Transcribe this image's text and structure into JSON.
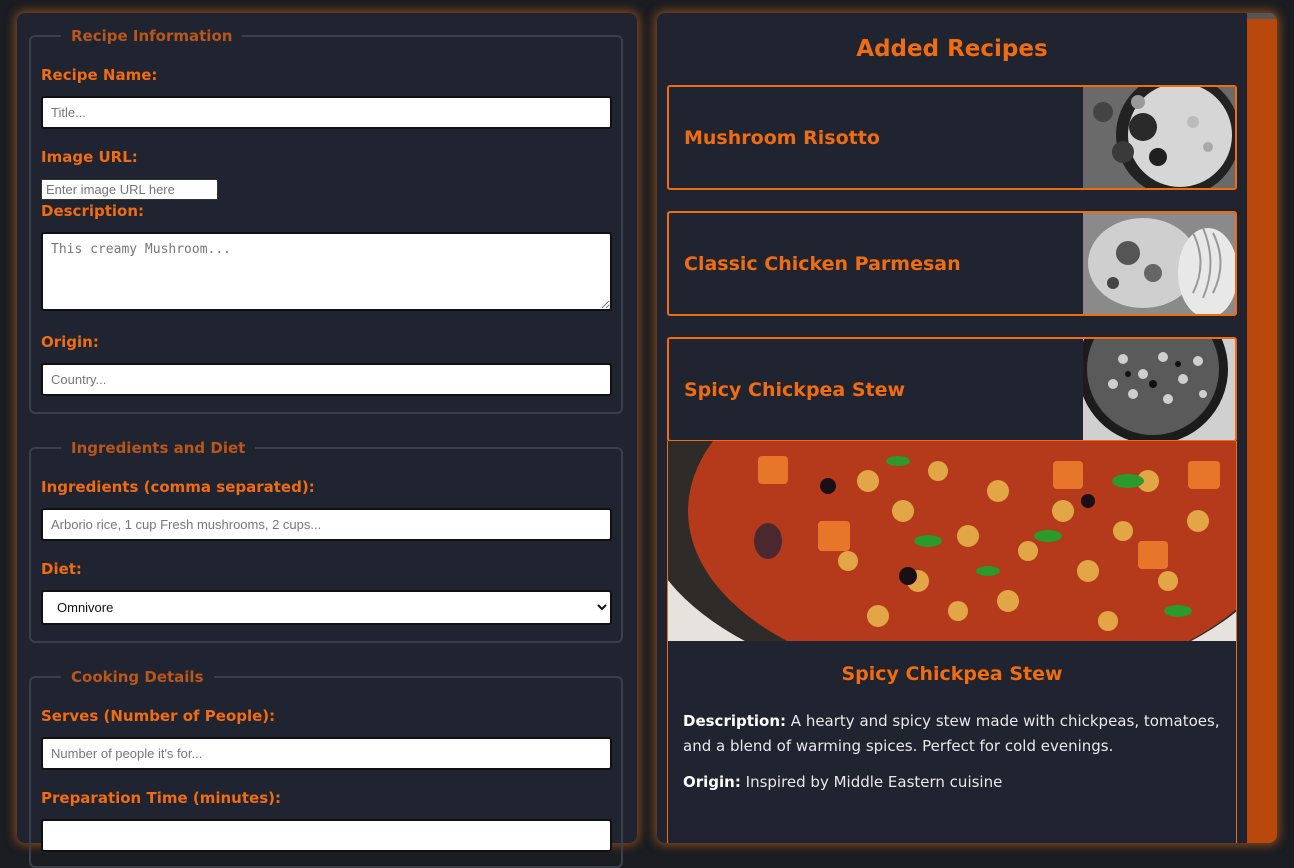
{
  "form": {
    "recipe_info": {
      "legend": "Recipe Information",
      "name_label": "Recipe Name:",
      "name_placeholder": "Title...",
      "image_label": "Image URL:",
      "image_placeholder": "Enter image URL here",
      "description_label": "Description:",
      "description_placeholder": "This creamy Mushroom...",
      "origin_label": "Origin:",
      "origin_placeholder": "Country..."
    },
    "ingredients_diet": {
      "legend": "Ingredients and Diet",
      "ingredients_label": "Ingredients (comma separated):",
      "ingredients_placeholder": "Arborio rice, 1 cup Fresh mushrooms, 2 cups...",
      "diet_label": "Diet:",
      "diet_selected": "Omnivore"
    },
    "cooking_details": {
      "legend": "Cooking Details",
      "serves_label": "Serves (Number of People):",
      "serves_placeholder": "Number of people it's for...",
      "prep_label": "Preparation Time (minutes):"
    }
  },
  "recipes": {
    "title": "Added Recipes",
    "cards": [
      {
        "name": "Mushroom Risotto"
      },
      {
        "name": "Classic Chicken Parmesan"
      },
      {
        "name": "Spicy Chickpea Stew"
      }
    ],
    "detail": {
      "name": "Spicy Chickpea Stew",
      "description_label": "Description:",
      "description": "A hearty and spicy stew made with chickpeas, tomatoes, and a blend of warming spices. Perfect for cold evenings.",
      "origin_label": "Origin:",
      "origin": "Inspired by Middle Eastern cuisine"
    }
  },
  "colors": {
    "accent": "#f06c12",
    "panel": "#1f2430",
    "background": "#1b1d22",
    "scrollbar": "#b9480c"
  }
}
